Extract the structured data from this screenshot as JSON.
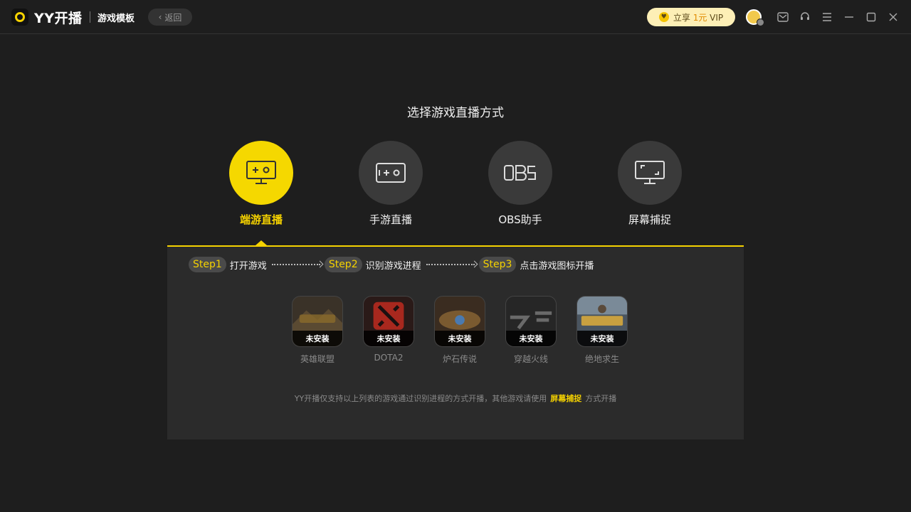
{
  "titlebar": {
    "app_name": "YY开播",
    "page_name": "游戏模板",
    "back_label": "返回",
    "vip": {
      "prefix": "立享",
      "price": "1元",
      "suffix": "VIP"
    }
  },
  "main": {
    "title": "选择游戏直播方式",
    "modes": [
      {
        "label": "端游直播",
        "icon": "monitor-game-icon",
        "active": true
      },
      {
        "label": "手游直播",
        "icon": "mobile-game-icon",
        "active": false
      },
      {
        "label": "OBS助手",
        "icon": "obs-icon",
        "active": false
      },
      {
        "label": "屏幕捕捉",
        "icon": "screen-capture-icon",
        "active": false
      }
    ],
    "steps": [
      {
        "badge": "Step1",
        "text": "打开游戏"
      },
      {
        "badge": "Step2",
        "text": "识别游戏进程"
      },
      {
        "badge": "Step3",
        "text": "点击游戏图标开播"
      }
    ],
    "games": [
      {
        "name": "英雄联盟",
        "status": "未安装"
      },
      {
        "name": "DOTA2",
        "status": "未安装"
      },
      {
        "name": "炉石传说",
        "status": "未安装"
      },
      {
        "name": "穿越火线",
        "status": "未安装"
      },
      {
        "name": "绝地求生",
        "status": "未安装"
      }
    ],
    "footnote": {
      "before": "YY开播仅支持以上列表的游戏通过识别进程的方式开播，其他游戏请使用",
      "link": "屏幕捕捉",
      "after": "方式开播"
    }
  },
  "colors": {
    "accent": "#f5d200",
    "background": "#1e1e1e",
    "panel": "#2b2b2b"
  }
}
